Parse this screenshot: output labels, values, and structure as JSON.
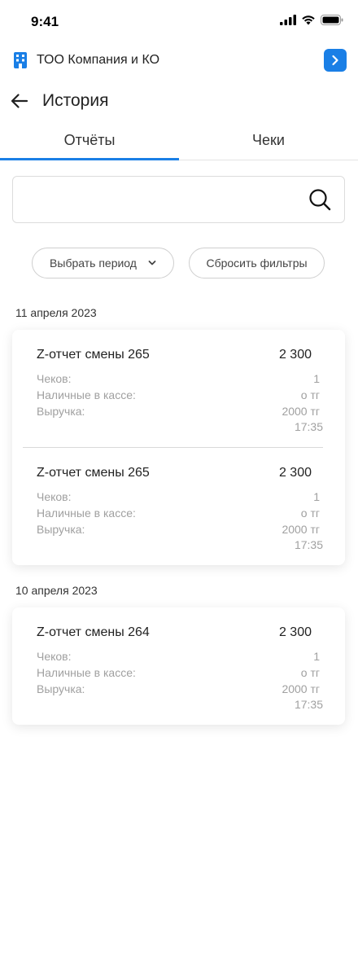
{
  "status_bar": {
    "time": "9:41"
  },
  "company": {
    "name": "ТОО Компания и КО"
  },
  "header": {
    "title": "История"
  },
  "tabs": [
    {
      "label": "Отчёты",
      "active": true
    },
    {
      "label": "Чеки",
      "active": false
    }
  ],
  "search": {
    "placeholder": "",
    "value": ""
  },
  "filters": {
    "period_label": "Выбрать период",
    "reset_label": "Сбросить фильтры"
  },
  "groups": [
    {
      "date": "11 апреля 2023",
      "reports": [
        {
          "title": "Z-отчет смены 265",
          "total": "2 300",
          "checks_label": "Чеков:",
          "checks_value": "1",
          "cash_label": "Наличные в кассе:",
          "cash_value": "о тг",
          "revenue_label": "Выручка:",
          "revenue_value": "2000 тг",
          "time": "17:35"
        },
        {
          "title": "Z-отчет смены 265",
          "total": "2 300",
          "checks_label": "Чеков:",
          "checks_value": "1",
          "cash_label": "Наличные в кассе:",
          "cash_value": "о тг",
          "revenue_label": "Выручка:",
          "revenue_value": "2000 тг",
          "time": "17:35"
        }
      ]
    },
    {
      "date": "10 апреля 2023",
      "reports": [
        {
          "title": "Z-отчет смены 264",
          "total": "2 300",
          "checks_label": "Чеков:",
          "checks_value": "1",
          "cash_label": "Наличные в кассе:",
          "cash_value": "о тг",
          "revenue_label": "Выручка:",
          "revenue_value": "2000 тг",
          "time": "17:35"
        }
      ]
    }
  ],
  "colors": {
    "accent": "#1a7fe6",
    "muted_text": "#a0a0a0",
    "divider": "#d9d9d9"
  },
  "icons": {
    "company": "building-icon",
    "switch": "chevron-right-icon",
    "back": "arrow-left-icon",
    "search": "search-icon",
    "dropdown": "chevron-down-icon"
  }
}
